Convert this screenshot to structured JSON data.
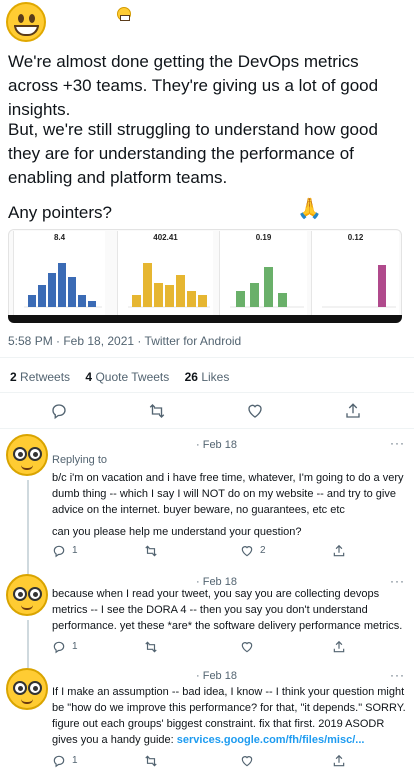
{
  "tweet": {
    "paragraphs": [
      "We're almost done getting the DevOps metrics across +30 teams. They're giving us a lot of good insights.",
      "But, we're still struggling to understand how good they are for understanding the performance of enabling and platform teams.",
      "Any pointers?"
    ],
    "meta": "5:58 PM · Feb 18, 2021 · Twitter for Android",
    "stats": {
      "retweets_count": "2",
      "retweets_label": "Retweets",
      "quotes_count": "4",
      "quotes_label": "Quote Tweets",
      "likes_count": "26",
      "likes_label": "Likes"
    }
  },
  "dashboard": {
    "panels": [
      {
        "value": "8.4",
        "color": "#3b6bb5"
      },
      {
        "value": "402.41",
        "color": "#e6b631"
      },
      {
        "value": "0.19",
        "color": "#6ab06a"
      },
      {
        "value": "0.12",
        "color": "#b04a8c"
      }
    ]
  },
  "replies": [
    {
      "time": "· Feb 18",
      "more": "···",
      "replying_to": "Replying to",
      "text": [
        "b/c i'm on vacation and i have free time, whatever, I'm going to do a very dumb thing -- which I say I will NOT do on my website -- and try to give advice on the internet. buyer beware, no guarantees, etc etc",
        "can you please help me understand your question?"
      ],
      "reply_count": "1",
      "like_count": "2"
    },
    {
      "time": "· Feb 18",
      "more": "···",
      "text": [
        "because when I read your tweet, you say you are collecting devops metrics -- I see the DORA 4 -- then you say you don't understand performance. yet these *are* the software delivery performance metrics."
      ],
      "reply_count": "1"
    },
    {
      "time": "· Feb 18",
      "more": "···",
      "text": [
        "If I make an assumption -- bad idea, I know -- I think your question might be \"how do we improve this performance? for that, \"it depends.\" SORRY. figure out each groups' biggest constraint. fix that first. 2019 ASODR gives you a handy guide:"
      ],
      "link": "services.google.com/fh/files/misc/...",
      "reply_count": "1"
    }
  ]
}
